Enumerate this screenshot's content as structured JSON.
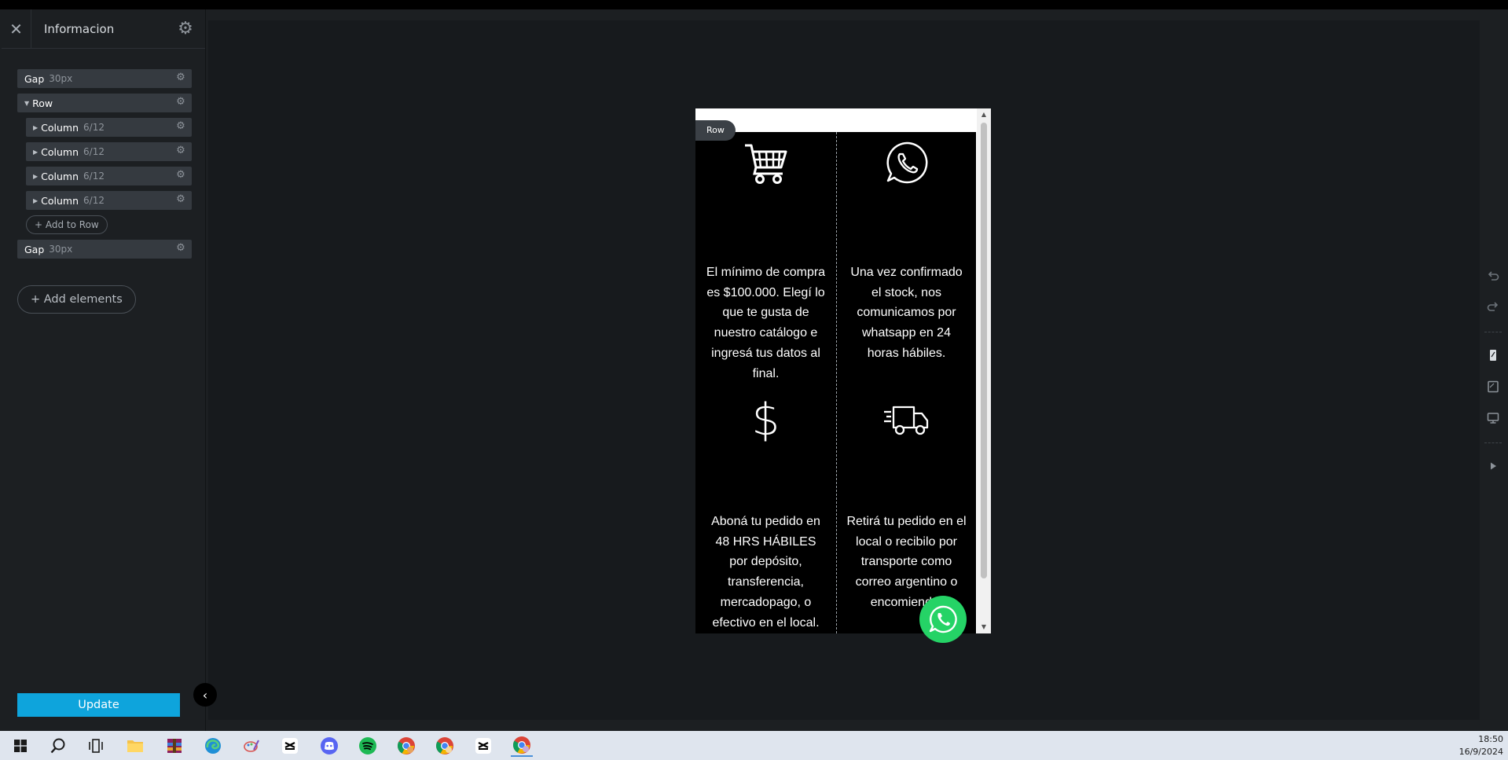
{
  "sidebar": {
    "title": "Informacion",
    "tree": [
      {
        "label": "Gap",
        "value": "30px"
      },
      {
        "label": "Row"
      },
      {
        "label": "Column",
        "value": "6/12"
      },
      {
        "label": "Column",
        "value": "6/12"
      },
      {
        "label": "Column",
        "value": "6/12"
      },
      {
        "label": "Column",
        "value": "6/12"
      },
      {
        "label": "Gap",
        "value": "30px"
      }
    ],
    "add_to_row": "+ Add to Row",
    "add_elements": "+ Add elements",
    "update": "Update"
  },
  "preview": {
    "row_badge": "Row",
    "cells": [
      {
        "icon": "shopping-cart-icon",
        "text": "El mínimo de compra es $100.000. Elegí lo que te gusta de nuestro catálogo e ingresá tus datos al final."
      },
      {
        "icon": "whatsapp-icon",
        "text": "Una vez confirmado el stock, nos comunicamos por whatsapp en 24 horas hábiles."
      },
      {
        "icon": "dollar-sign-icon",
        "glyph": "$",
        "text": "Aboná tu pedido en 48 HRS HÁBILES por depósito, transferencia, mercadopago, o efectivo en el local."
      },
      {
        "icon": "delivery-truck-icon",
        "text": "Retirá tu pedido en el local o recibilo por transporte como correo argentino o encomienda."
      }
    ]
  },
  "right_toolbar": [
    "undo-icon",
    "redo-icon",
    "mobile-view-icon",
    "tablet-view-icon",
    "desktop-view-icon",
    "play-icon"
  ],
  "taskbar": {
    "apps": [
      "windows-start-icon",
      "search-icon",
      "task-view-icon",
      "file-explorer-icon",
      "winrar-icon",
      "edge-icon",
      "paint-icon",
      "capcut-icon",
      "discord-icon",
      "spotify-icon",
      "chrome-icon",
      "chrome-profile-icon",
      "capcut-icon",
      "chrome-active-icon"
    ],
    "time": "18:50",
    "date": "16/9/2024"
  },
  "colors": {
    "accent": "#0ea4dc",
    "whatsapp": "#25d366",
    "panel": "#1c1f22",
    "node": "#353a40"
  }
}
